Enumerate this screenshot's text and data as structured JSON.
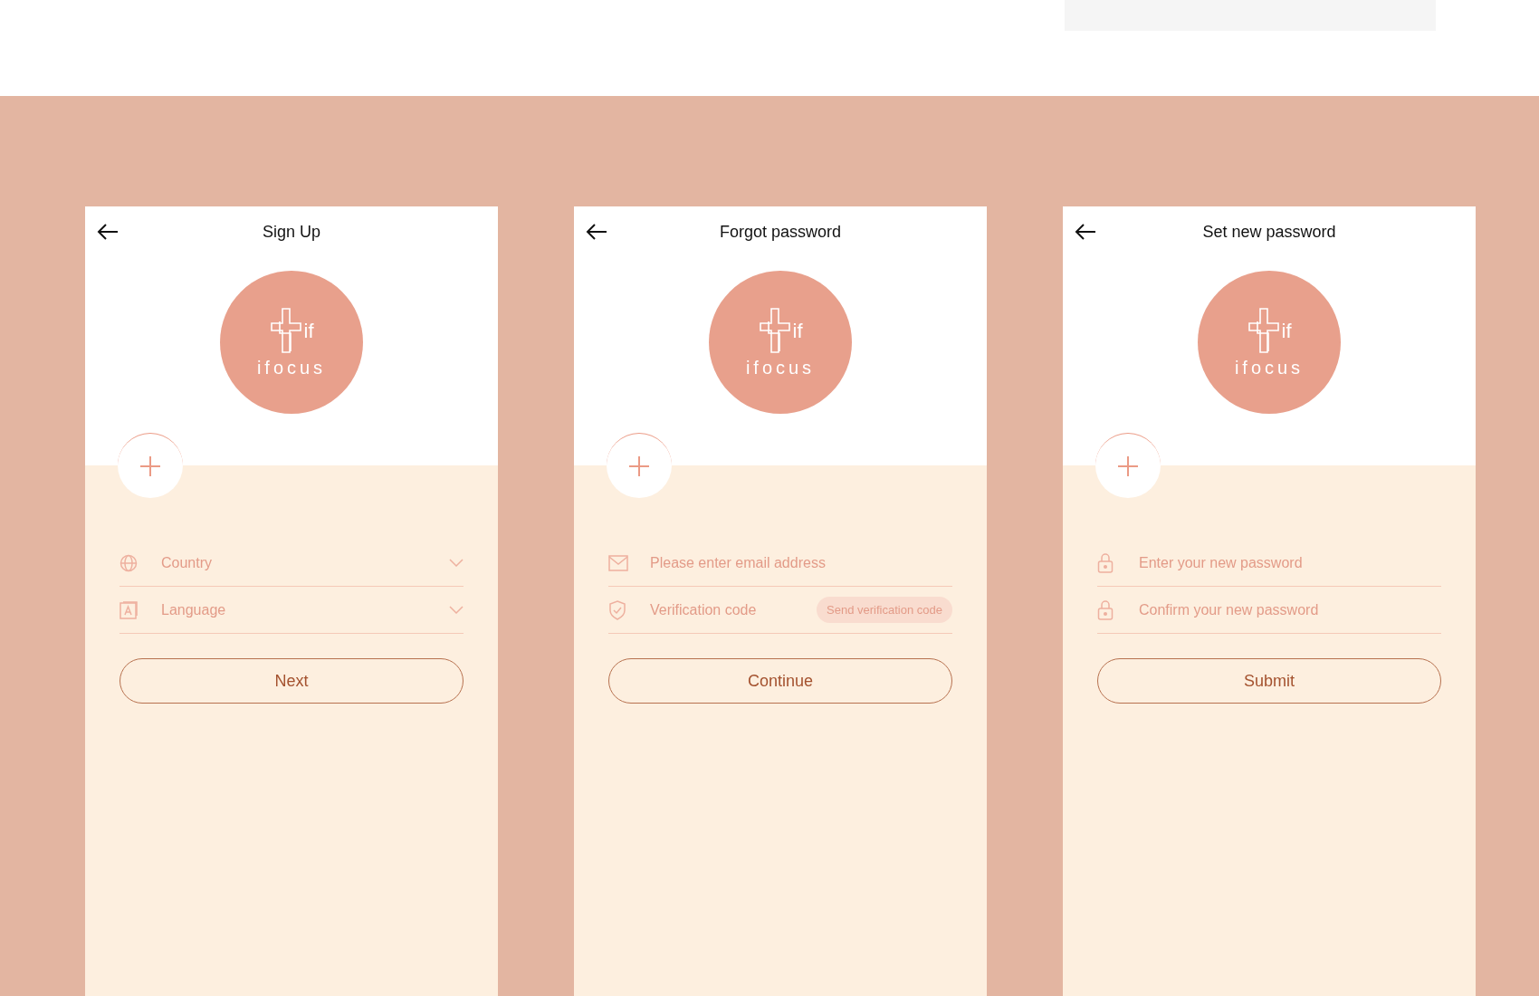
{
  "screens": [
    {
      "title": "Sign Up",
      "logo": {
        "mark": "if",
        "name": "ifocus"
      },
      "fields": [
        {
          "kind": "country",
          "placeholder": "Country"
        },
        {
          "kind": "language",
          "placeholder": "Language"
        }
      ],
      "button": "Next"
    },
    {
      "title": "Forgot password",
      "logo": {
        "mark": "if",
        "name": "ifocus"
      },
      "fields": [
        {
          "kind": "email",
          "placeholder": "Please enter email address"
        },
        {
          "kind": "code",
          "placeholder": "Verification code",
          "action": "Send verification code"
        }
      ],
      "button": "Continue"
    },
    {
      "title": "Set new password",
      "logo": {
        "mark": "if",
        "name": "ifocus"
      },
      "fields": [
        {
          "kind": "password",
          "placeholder": "Enter your new password"
        },
        {
          "kind": "password",
          "placeholder": "Confirm your new password"
        }
      ],
      "button": "Submit"
    }
  ]
}
